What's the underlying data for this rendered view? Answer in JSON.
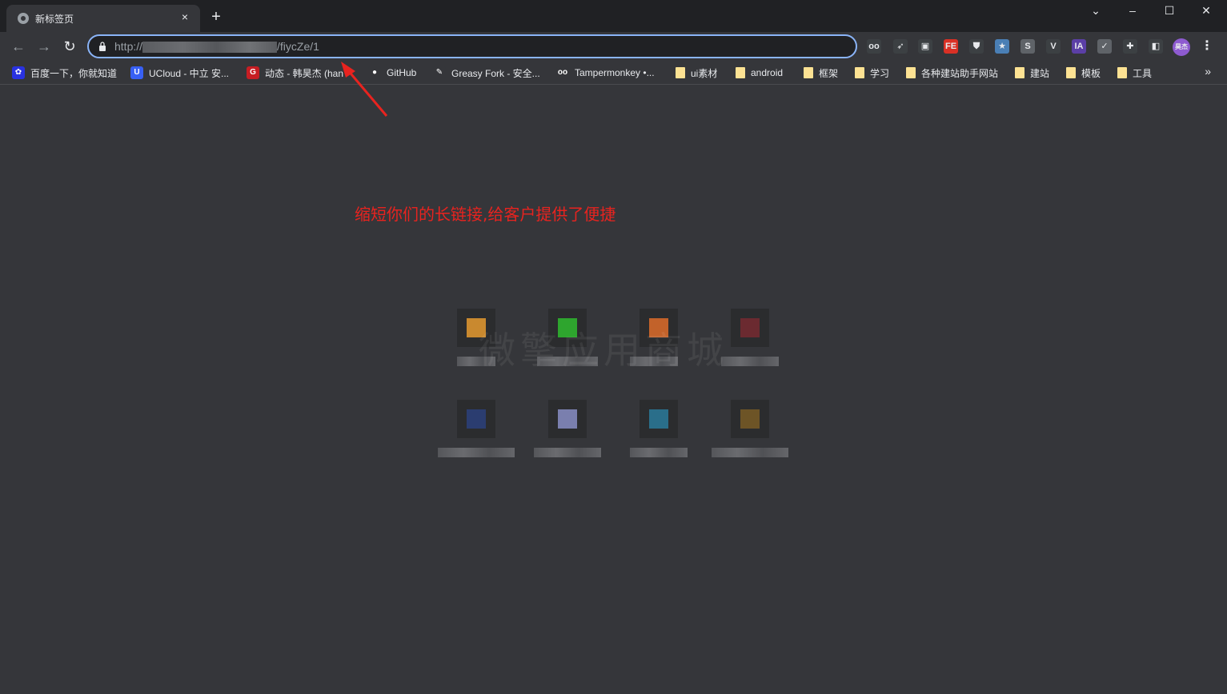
{
  "tab": {
    "title": "新标签页",
    "close": "×"
  },
  "newtab": "+",
  "window_controls": {
    "minimize": "–",
    "maximize": "☐",
    "close": "✕",
    "tab_search": "⌄"
  },
  "nav": {
    "back": "←",
    "forward": "→",
    "reload": "↻"
  },
  "omnibox": {
    "url_prefix": "http://",
    "url_suffix": "/fiycZe/1"
  },
  "extensions": [
    {
      "name": "extension-oo",
      "glyph": "oo",
      "color": "#3c4043"
    },
    {
      "name": "extension-cursor",
      "glyph": "➶",
      "color": "#3c4043"
    },
    {
      "name": "extension-square",
      "glyph": "▣",
      "color": "#3c4043"
    },
    {
      "name": "extension-fe",
      "glyph": "FE",
      "color": "#d93025"
    },
    {
      "name": "extension-shield",
      "glyph": "⛊",
      "color": "#3c4043"
    },
    {
      "name": "extension-star",
      "glyph": "★",
      "color": "#4a7fb5"
    },
    {
      "name": "extension-s",
      "glyph": "S",
      "color": "#5f6368"
    },
    {
      "name": "extension-v",
      "glyph": "V",
      "color": "#3c4043"
    },
    {
      "name": "extension-ia",
      "glyph": "IA",
      "color": "#5b3fa6"
    },
    {
      "name": "extension-check-shield",
      "glyph": "✓",
      "color": "#5f6368"
    },
    {
      "name": "extension-puzzle",
      "glyph": "✚",
      "color": "#3c4043"
    },
    {
      "name": "side-panel",
      "glyph": "◧",
      "color": "#3c4043"
    }
  ],
  "profile": {
    "initials": "昊杰",
    "color": "#8e5bd0"
  },
  "menu": "⋮",
  "bookmarks": [
    {
      "label": "百度一下，你就知道",
      "icon": "baidu",
      "color": "#2932e1",
      "glyph": "✿"
    },
    {
      "label": "UCloud - 中立 安...",
      "icon": "ucloud",
      "color": "#3860f4",
      "glyph": "U"
    },
    {
      "label": "动态 - 韩昊杰 (han",
      "icon": "gitee",
      "color": "#c71d23",
      "glyph": "G"
    },
    {
      "label": "GitHub",
      "icon": "github",
      "color": "#35363a",
      "glyph": "●"
    },
    {
      "label": "Greasy Fork - 安全...",
      "icon": "greasyfork",
      "color": "#35363a",
      "glyph": "✎"
    },
    {
      "label": "Tampermonkey •...",
      "icon": "tampermonkey",
      "color": "#35363a",
      "glyph": "oo"
    },
    {
      "label": "ui素材",
      "icon": "folder"
    },
    {
      "label": "android",
      "icon": "folder"
    },
    {
      "label": "框架",
      "icon": "folder"
    },
    {
      "label": "学习",
      "icon": "folder"
    },
    {
      "label": "各种建站助手网站",
      "icon": "folder"
    },
    {
      "label": "建站",
      "icon": "folder"
    },
    {
      "label": "模板",
      "icon": "folder"
    },
    {
      "label": "工具",
      "icon": "folder"
    }
  ],
  "bookmarks_more": "»",
  "annotation": "缩短你们的长链接,给客户提供了便捷",
  "watermark": "微擎应用商城",
  "shortcuts": [
    {
      "name": "shortcut-1",
      "color": "#c9892f"
    },
    {
      "name": "shortcut-2",
      "color": "#2ea52e"
    },
    {
      "name": "shortcut-3",
      "color": "#c2622a"
    },
    {
      "name": "shortcut-4",
      "color": "#6b2a30"
    },
    {
      "name": "shortcut-5",
      "color": "#2b3d70"
    },
    {
      "name": "shortcut-6",
      "color": "#7a7fae"
    },
    {
      "name": "shortcut-7",
      "color": "#2a6e8a"
    },
    {
      "name": "shortcut-8",
      "color": "#6d5426"
    }
  ]
}
